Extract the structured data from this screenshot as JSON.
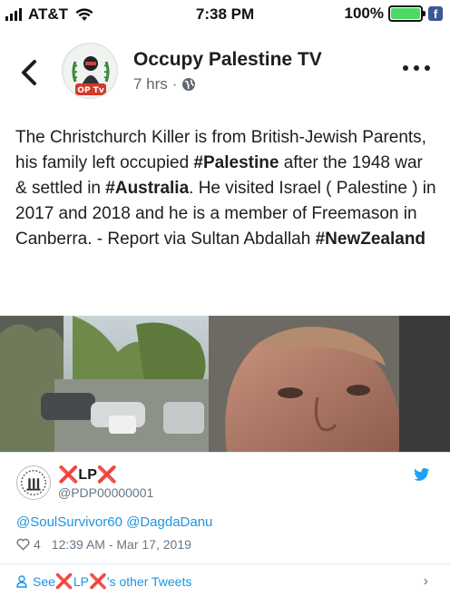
{
  "status_bar": {
    "carrier": "AT&T",
    "time": "7:38 PM",
    "battery": "100%",
    "battery_level": 1.0
  },
  "header": {
    "page_name": "Occupy Palestine TV",
    "time_ago": "7 hrs",
    "separator": "·",
    "avatar_label": "OP Tv"
  },
  "post": {
    "segments": [
      {
        "text": "The Christchurch Killer is from British-Jewish Parents, his family left occupied ",
        "bold": false
      },
      {
        "text": "#Palestine",
        "bold": true
      },
      {
        "text": " after the 1948 war & settled in ",
        "bold": false
      },
      {
        "text": "#Australia",
        "bold": true
      },
      {
        "text": ". He visited Israel ( Palestine ) in 2017 and 2018 and he is a member of Freemason in Canberra. - Report via Sultan Abdallah ",
        "bold": false
      },
      {
        "text": "#NewZealand",
        "bold": true
      }
    ]
  },
  "tweet": {
    "name_mid": "LP",
    "name_mark": "❌",
    "handle": "@PDP00000001",
    "body": "@SoulSurvivor60 @DagdaDanu",
    "likes": "4",
    "timestamp": "12:39 AM - Mar 17, 2019",
    "footer_prefix": "See ",
    "footer_mid": "LP",
    "footer_suffix": "'s other Tweets"
  },
  "icons": {
    "back": "chevron-left-icon",
    "more": "more-dots-icon",
    "globe": "globe-icon",
    "twitter": "twitter-bird-icon",
    "heart": "heart-outline-icon",
    "person": "person-icon",
    "chevron": "chevron-right-icon"
  },
  "colors": {
    "battery_green": "#4cd964",
    "twitter_blue": "#1b95e0",
    "twitter_red_x": "#e0245e",
    "meta_gray": "#606770"
  }
}
